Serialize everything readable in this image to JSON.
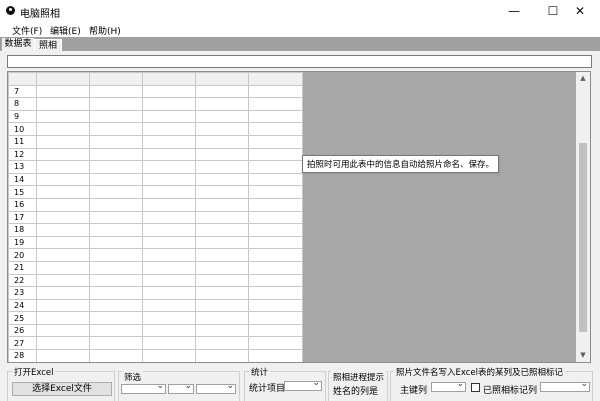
{
  "window": {
    "title": "电脑照相",
    "minimize_glyph": "—",
    "maximize_glyph": "☐",
    "close_glyph": "✕"
  },
  "menu": {
    "items": [
      "文件(F)",
      "编辑(E)",
      "帮助(H)"
    ]
  },
  "tabs": {
    "items": [
      "数据表",
      "照相"
    ]
  },
  "grid": {
    "rows": [
      "7",
      "8",
      "9",
      "10",
      "11",
      "12",
      "13",
      "14",
      "15",
      "16",
      "17",
      "18",
      "19",
      "20",
      "21",
      "22",
      "23",
      "24",
      "25",
      "26",
      "27",
      "28"
    ]
  },
  "tooltip": {
    "text": "拍照时可用此表中的信息自动给照片命名、保存。"
  },
  "bottom": {
    "open_excel": {
      "title": "打开Excel",
      "button": "选择Excel文件"
    },
    "filter": {
      "title": "筛选"
    },
    "stats": {
      "title": "统计",
      "item_label": "统计项目"
    },
    "progress": {
      "title": "照相进程提示",
      "line": "姓名的列是"
    },
    "naming": {
      "title": "照片文件名写入Excel表的某列及已照相标记",
      "key_col_label": "主键列",
      "checkbox_label": "已照相标记列"
    }
  }
}
